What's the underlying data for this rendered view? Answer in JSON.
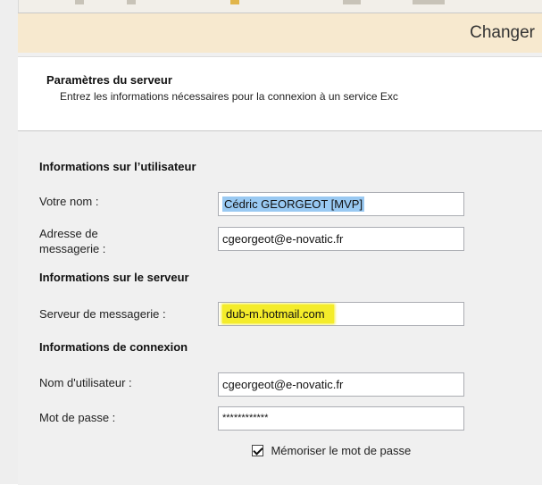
{
  "window": {
    "title": "Changer"
  },
  "header": {
    "title": "Paramètres du serveur",
    "description": "Entrez les informations nécessaires pour la connexion à un service Exc"
  },
  "user_info": {
    "heading": "Informations sur l’utilisateur",
    "name_label": "Votre nom :",
    "name_value": "Cédric GEORGEOT [MVP]",
    "email_label_line1": "Adresse de",
    "email_label_line2": "messagerie :",
    "email_value": "cgeorgeot@e-novatic.fr"
  },
  "server_info": {
    "heading": "Informations sur le serveur",
    "server_label": "Serveur de messagerie :",
    "server_value": "dub-m.hotmail.com"
  },
  "login_info": {
    "heading": "Informations de connexion",
    "username_label": "Nom d'utilisateur :",
    "username_value": "cgeorgeot@e-novatic.fr",
    "password_label": "Mot de passe :",
    "password_value": "************",
    "remember_label": "Mémoriser le mot de passe",
    "remember_checked": true
  },
  "colors": {
    "title_bar": "#f7e9cf",
    "selection": "#99c9f2",
    "highlight": "#f4ec2a"
  }
}
